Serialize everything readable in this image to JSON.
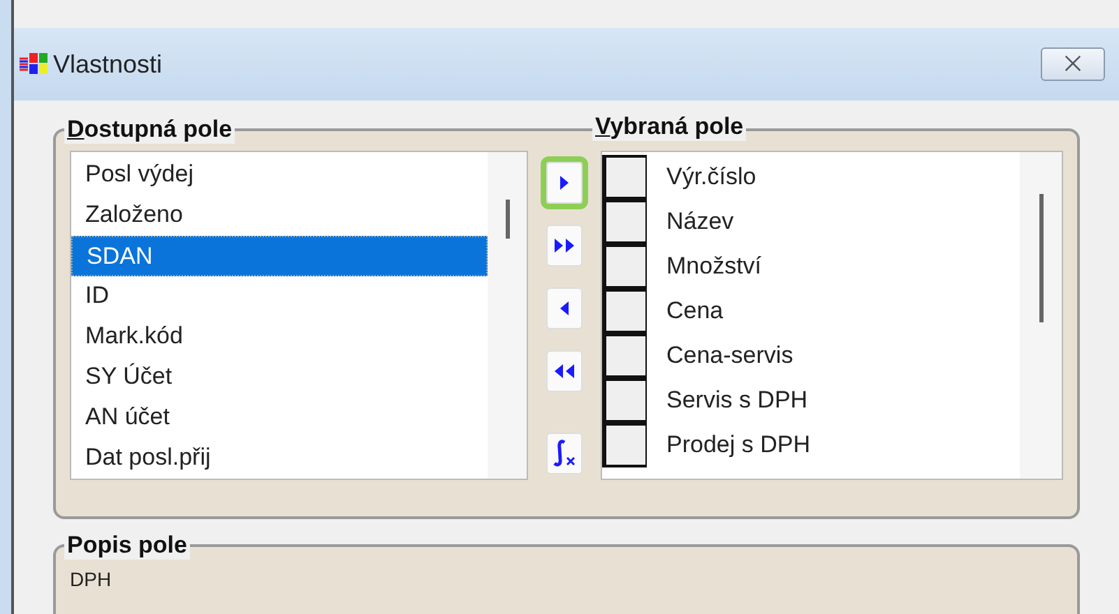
{
  "window": {
    "title": "Vlastnosti",
    "close": "⨉"
  },
  "available": {
    "label": "Dostupná pole",
    "accelerator_underlined": true,
    "items": [
      {
        "text": "Posl výdej",
        "selected": false
      },
      {
        "text": "Založeno",
        "selected": false
      },
      {
        "text": "SDAN",
        "selected": true
      },
      {
        "text": "ID",
        "selected": false
      },
      {
        "text": "Mark.kód",
        "selected": false
      },
      {
        "text": "SY Účet",
        "selected": false
      },
      {
        "text": "AN účet",
        "selected": false
      },
      {
        "text": "Dat posl.přij",
        "selected": false
      }
    ]
  },
  "buttons": [
    {
      "kind": "add",
      "highlighted": true
    },
    {
      "kind": "add_all",
      "highlighted": false
    },
    {
      "kind": "remove",
      "highlighted": false
    },
    {
      "kind": "remove_all",
      "highlighted": false
    },
    {
      "kind": "formula",
      "highlighted": false
    }
  ],
  "chosen": {
    "label": "Vybraná pole",
    "accelerator_underlined": true,
    "items": [
      {
        "text": "Výr.číslo",
        "checked": false
      },
      {
        "text": "Název",
        "checked": false
      },
      {
        "text": "Množství",
        "checked": false
      },
      {
        "text": "Cena",
        "checked": false
      },
      {
        "text": "Cena-servis",
        "checked": false
      },
      {
        "text": "Servis s DPH",
        "checked": false
      },
      {
        "text": "Prodej s DPH",
        "checked": false
      }
    ]
  },
  "description": {
    "label": "Popis pole",
    "accelerator_underlined": false,
    "text": "DPH"
  }
}
